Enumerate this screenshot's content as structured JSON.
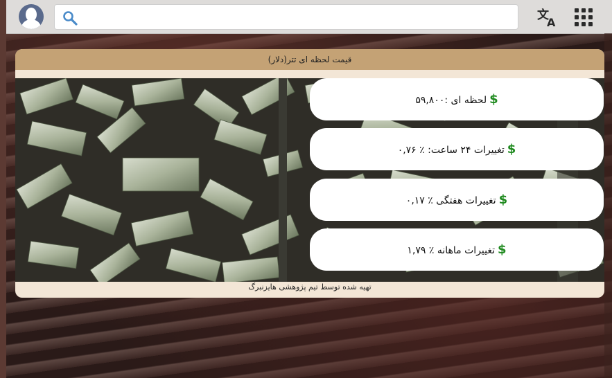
{
  "topbar": {
    "avatar_icon": "user-avatar-icon",
    "search": {
      "placeholder": "",
      "value": "",
      "icon": "search-icon"
    },
    "translate_icon": "translate-icon",
    "apps_icon": "apps-grid-icon"
  },
  "card": {
    "header": "قیمت لحظه ای تتر(دلار)",
    "stats": [
      {
        "label": "لحظه ای :۵۹,۸۰۰",
        "symbol": "$"
      },
      {
        "label": "تغییرات ۲۴ ساعت: ٪ ۰,۷۶",
        "symbol": "$"
      },
      {
        "label": "تغییرات هفتگی ٪ ۰,۱۷",
        "symbol": "$"
      },
      {
        "label": "تغییرات ماهانه ٪ ۱,۷۹",
        "symbol": "$"
      }
    ],
    "footer": "تهیه شده توسط تیم پژوهشی هایزنبرگ",
    "image": "flying-dollar-bills-photo"
  },
  "colors": {
    "header_bg": "#c4a275",
    "card_bg": "#f3e6d6",
    "dollar_green": "#1f8a1f",
    "topbar_bg": "#dedcda"
  }
}
